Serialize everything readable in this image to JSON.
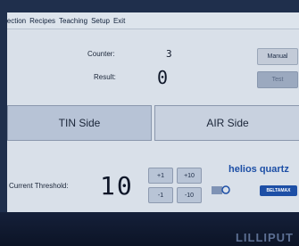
{
  "menu": [
    "lection",
    "Recipes",
    "Teaching",
    "Setup",
    "Exit"
  ],
  "counter": {
    "label": "Counter:",
    "value": "3"
  },
  "result": {
    "label": "Result:",
    "value": "0"
  },
  "buttons": {
    "manual": "Manual",
    "test": "Test"
  },
  "sides": {
    "tin": "TIN Side",
    "air": "AIR Side"
  },
  "threshold": {
    "label": "Current Threshold:",
    "value": "10"
  },
  "steps": {
    "plus1": "+1",
    "plus10": "+10",
    "minus1": "-1",
    "minus10": "-10"
  },
  "logo": {
    "brand": "helios quartz",
    "partner": "BELTAMAX"
  },
  "device_brand": "LILLIPUT"
}
